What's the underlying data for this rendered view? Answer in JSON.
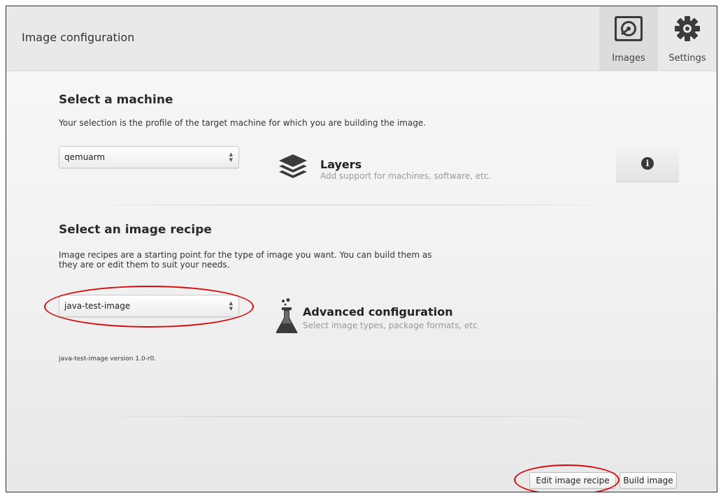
{
  "header": {
    "title": "Image configuration",
    "tabs": [
      {
        "label": "Images",
        "icon": "hard-disk-icon"
      },
      {
        "label": "Settings",
        "icon": "gear-icon"
      }
    ]
  },
  "machine": {
    "title": "Select a machine",
    "description": "Your selection is the profile of the target machine for which you are building the image.",
    "selected": "qemuarm",
    "layers_title": "Layers",
    "layers_subtitle": "Add support for machines, software, etc."
  },
  "recipe": {
    "title": "Select an image recipe",
    "description_line1": "Image recipes are a starting point for the type of image you want. You can build them as",
    "description_line2": "they are or edit them to suit your needs.",
    "selected": "java-test-image",
    "advanced_title": "Advanced configuration",
    "advanced_subtitle": "Select image types, package formats, etc",
    "version_text": "java-test-image version 1.0-r0."
  },
  "footer": {
    "edit_label": "Edit image recipe",
    "build_label": "Build image"
  },
  "annotation_color": "#d90a0a"
}
